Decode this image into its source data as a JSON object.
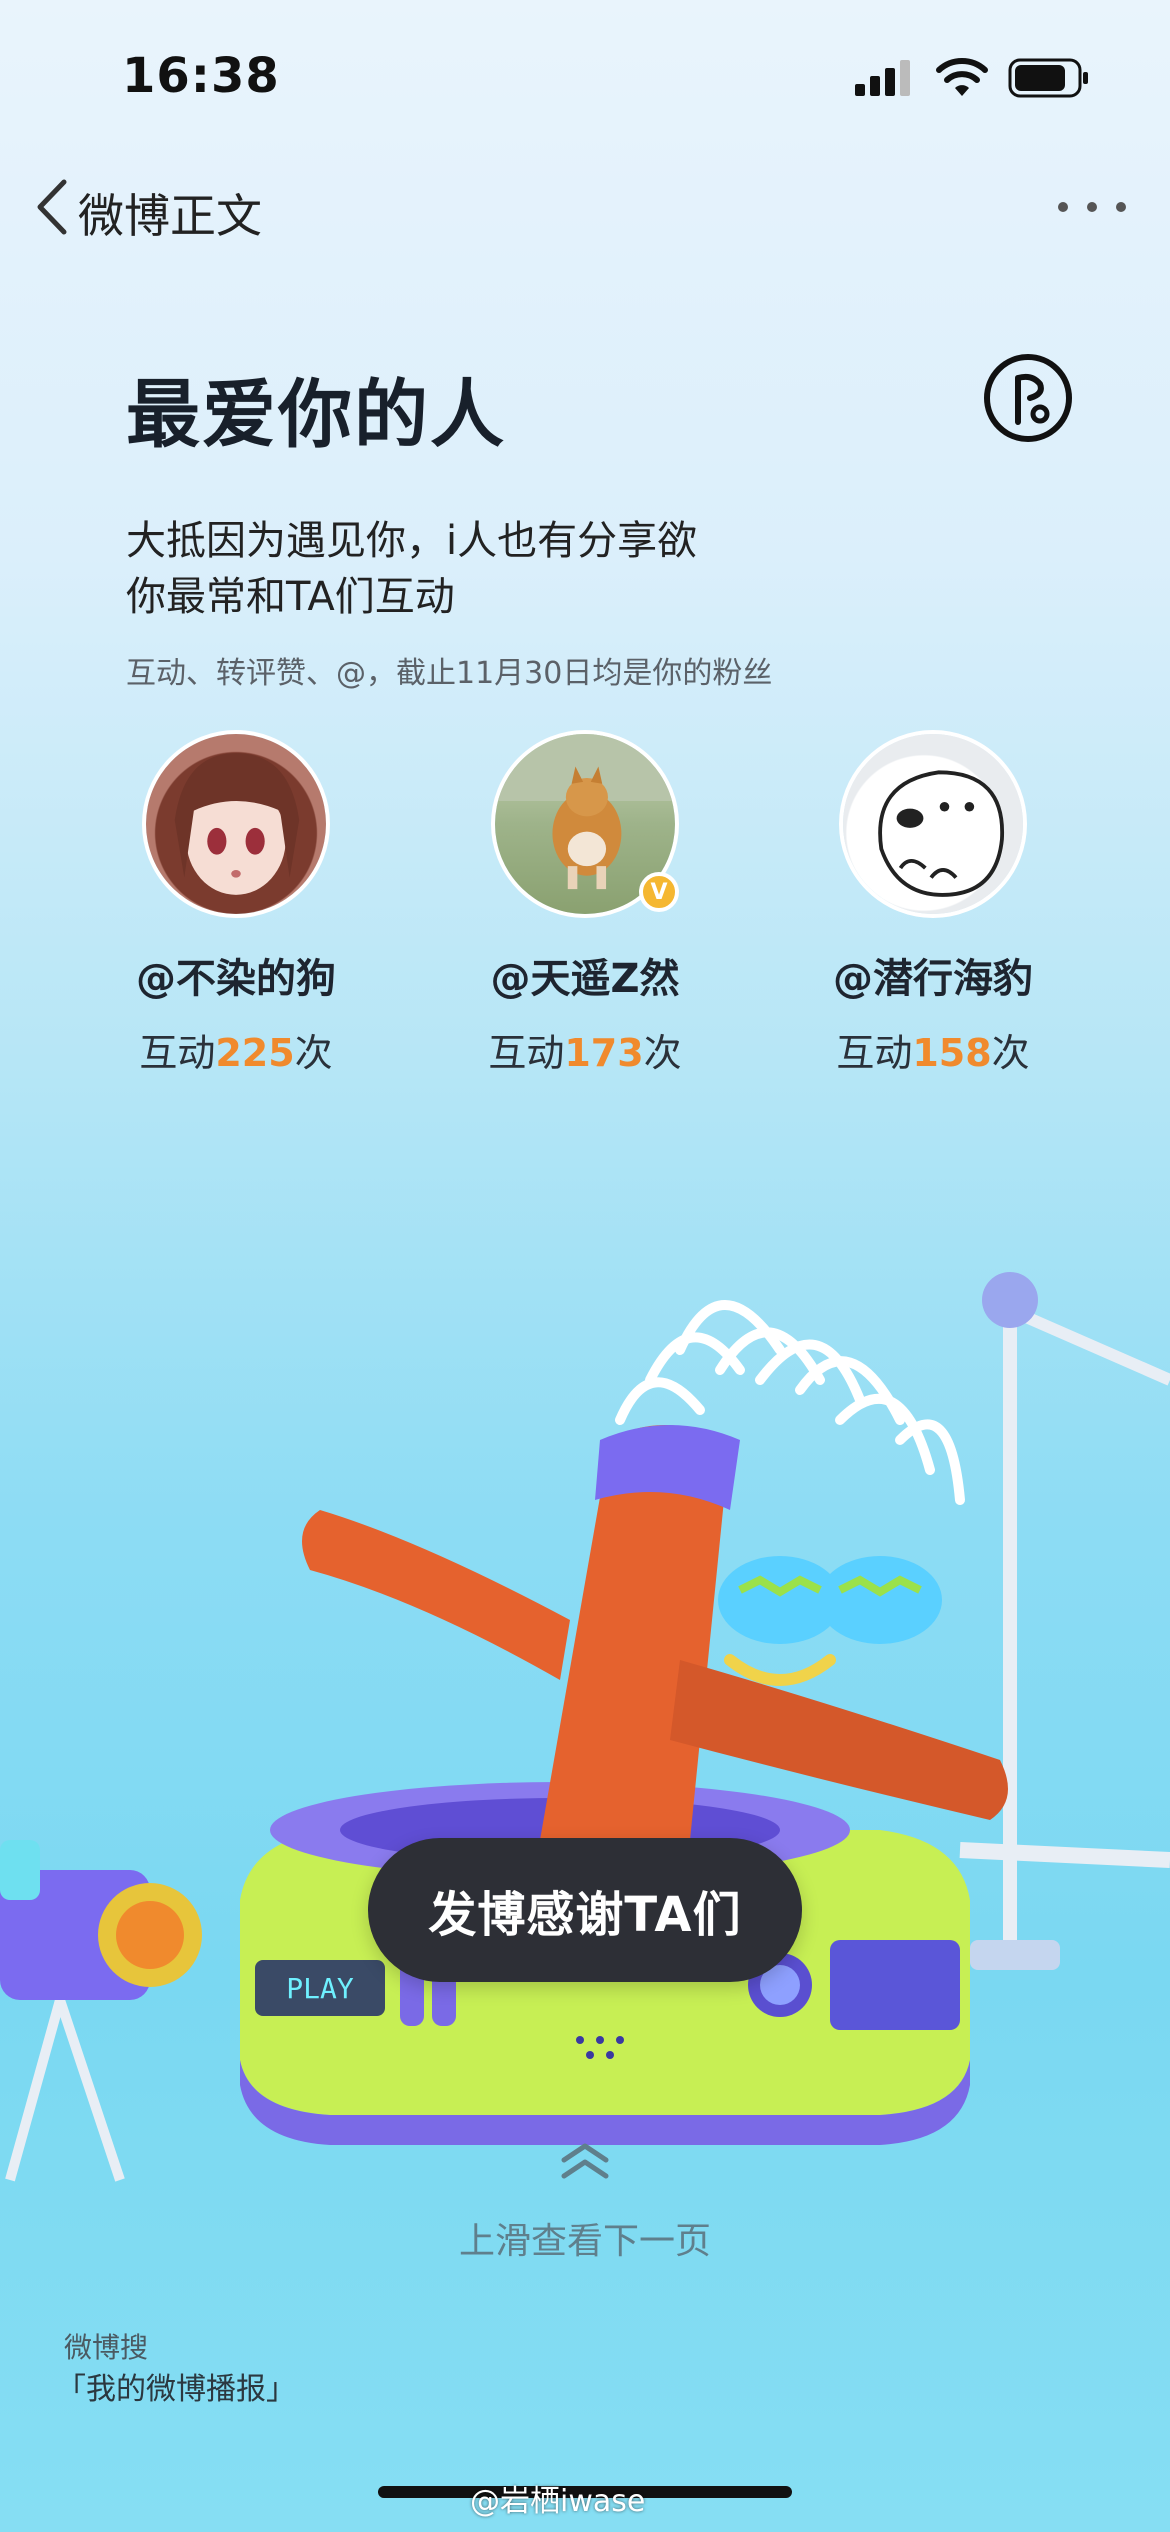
{
  "status_bar": {
    "time": "16:38",
    "icons": [
      "signal-icon",
      "wifi-icon",
      "battery-icon"
    ]
  },
  "nav": {
    "back_icon": "chevron-left-icon",
    "title": "微博正文",
    "more_icon": "more-horizontal-icon"
  },
  "header": {
    "title": "最爱你的人",
    "music_icon": "music-note-icon",
    "subtitle_line1": "大抵因为遇见你，i人也有分享欲",
    "subtitle_line2": "你最常和TA们互动",
    "note": "互动、转评赞、@，截止11月30日均是你的粉丝"
  },
  "users": [
    {
      "name": "@不染的狗",
      "prefix": "互动",
      "count": "225",
      "suffix": "次",
      "verified": false
    },
    {
      "name": "@天遥Z然",
      "prefix": "互动",
      "count": "173",
      "suffix": "次",
      "verified": true,
      "badge": "V"
    },
    {
      "name": "@潜行海豹",
      "prefix": "互动",
      "count": "158",
      "suffix": "次",
      "verified": false
    }
  ],
  "scene": {
    "screen_text": "PLAY"
  },
  "cta": {
    "label": "发博感谢TA们"
  },
  "swipe": {
    "icon": "double-chevron-up-icon",
    "label": "上滑查看下一页"
  },
  "footer": {
    "line1": "微博搜",
    "line2": "「我的微博播报」"
  },
  "watermark": "@岩栖iwase",
  "colors": {
    "accent_count": "#f08a2d",
    "cta_bg": "#2d2f36",
    "verified": "#f5b731"
  }
}
